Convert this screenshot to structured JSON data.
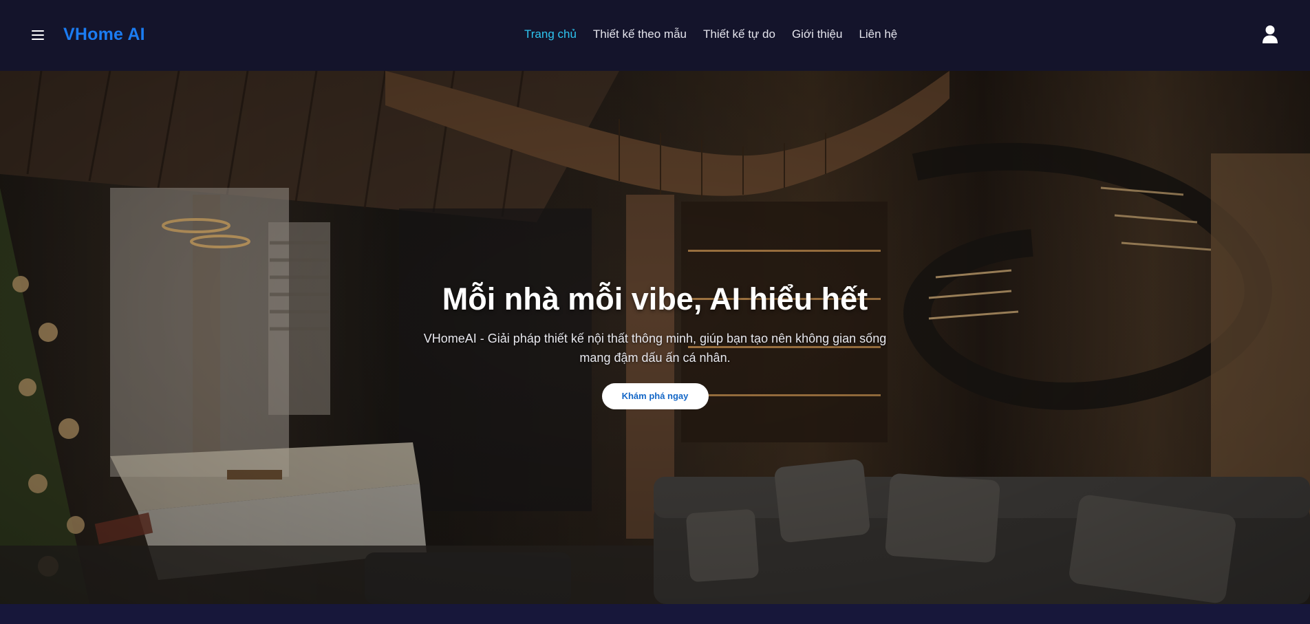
{
  "header": {
    "brand": "VHome AI",
    "nav": [
      {
        "label": "Trang chủ",
        "active": true
      },
      {
        "label": "Thiết kế theo mẫu",
        "active": false
      },
      {
        "label": "Thiết kế tự do",
        "active": false
      },
      {
        "label": "Giới thiệu",
        "active": false
      },
      {
        "label": "Liên hệ",
        "active": false
      }
    ],
    "menu_icon": "hamburger-menu-icon",
    "user_icon": "user-icon"
  },
  "hero": {
    "title": "Mỗi nhà mỗi vibe, AI hiểu hết",
    "subtitle": "VHomeAI - Giải pháp thiết kế nội thất thông minh, giúp bạn tạo nên không gian sống mang đậm dấu ấn cá nhân.",
    "cta_label": "Khám phá ngay"
  },
  "colors": {
    "nav_bg": "#14142b",
    "brand": "#1b7cf2",
    "nav_active": "#2ec5f0",
    "cta_text": "#1467c7"
  }
}
